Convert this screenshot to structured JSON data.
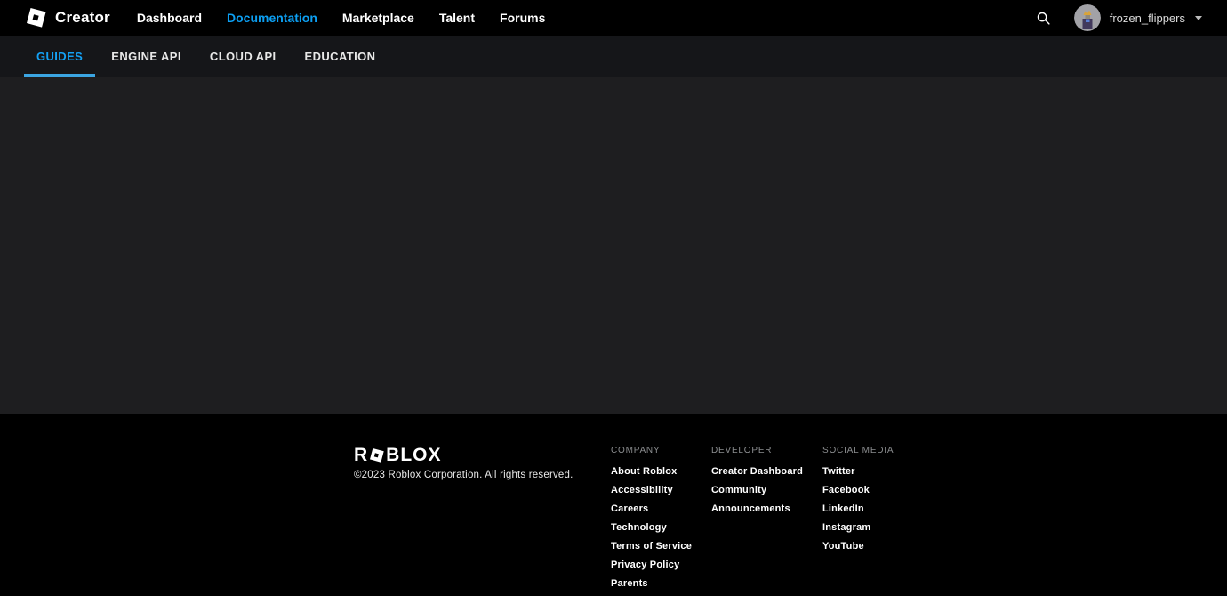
{
  "colors": {
    "accent_blue": "#0c9ff2",
    "tab_underline": "#3ba5e2",
    "header_bg": "#000000",
    "tabbar_bg": "#151619",
    "main_bg": "#1e1e20",
    "footer_bg": "#000000"
  },
  "header": {
    "brand": "Creator",
    "nav": [
      {
        "label": "Dashboard",
        "active": false
      },
      {
        "label": "Documentation",
        "active": true
      },
      {
        "label": "Marketplace",
        "active": false
      },
      {
        "label": "Talent",
        "active": false
      },
      {
        "label": "Forums",
        "active": false
      }
    ],
    "icons": {
      "brand_logo": "roblox-logo",
      "search": "search-icon",
      "user_caret": "chevron-down-icon"
    },
    "user": {
      "name": "frozen_flippers"
    }
  },
  "tabs": [
    {
      "label": "GUIDES",
      "active": true
    },
    {
      "label": "ENGINE API",
      "active": false
    },
    {
      "label": "CLOUD API",
      "active": false
    },
    {
      "label": "EDUCATION",
      "active": false
    }
  ],
  "footer": {
    "logo": {
      "prefix": "R",
      "suffix": "BLOX",
      "o_icon": "roblox-tilted-square"
    },
    "copyright": "©2023 Roblox Corporation. All rights reserved.",
    "columns": [
      {
        "title": "COMPANY",
        "links": [
          "About Roblox",
          "Accessibility",
          "Careers",
          "Technology",
          "Terms of Service",
          "Privacy Policy",
          "Parents"
        ]
      },
      {
        "title": "DEVELOPER",
        "links": [
          "Creator Dashboard",
          "Community",
          "Announcements"
        ]
      },
      {
        "title": "SOCIAL MEDIA",
        "links": [
          "Twitter",
          "Facebook",
          "LinkedIn",
          "Instagram",
          "YouTube"
        ]
      }
    ]
  }
}
